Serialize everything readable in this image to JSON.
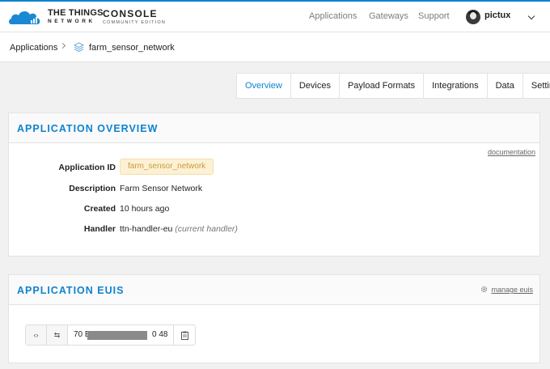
{
  "brand": {
    "name": "THE THINGS",
    "sub": "NETWORK",
    "console": "CONSOLE",
    "console_sub": "COMMUNITY EDITION"
  },
  "nav": {
    "applications": "Applications",
    "gateways": "Gateways",
    "support": "Support",
    "user": "pictux"
  },
  "breadcrumb": {
    "root": "Applications",
    "current": "farm_sensor_network"
  },
  "tabs": [
    "Overview",
    "Devices",
    "Payload Formats",
    "Integrations",
    "Data",
    "Settings"
  ],
  "overview": {
    "title": "APPLICATION OVERVIEW",
    "doc_link": "documentation",
    "app_id_label": "Application ID",
    "app_id": "farm_sensor_network",
    "description_label": "Description",
    "description": "Farm Sensor Network",
    "created_label": "Created",
    "created": "10 hours ago",
    "handler_label": "Handler",
    "handler": "ttn-handler-eu",
    "handler_note": "(current handler)"
  },
  "euis": {
    "title": "APPLICATION EUIS",
    "manage": "manage euis",
    "eui_prefix": "70 B",
    "eui_suffix": "0 48"
  },
  "colors": {
    "accent": "#0d83d0",
    "badge_bg": "#fdf1d5",
    "badge_text": "#c89b3a"
  }
}
